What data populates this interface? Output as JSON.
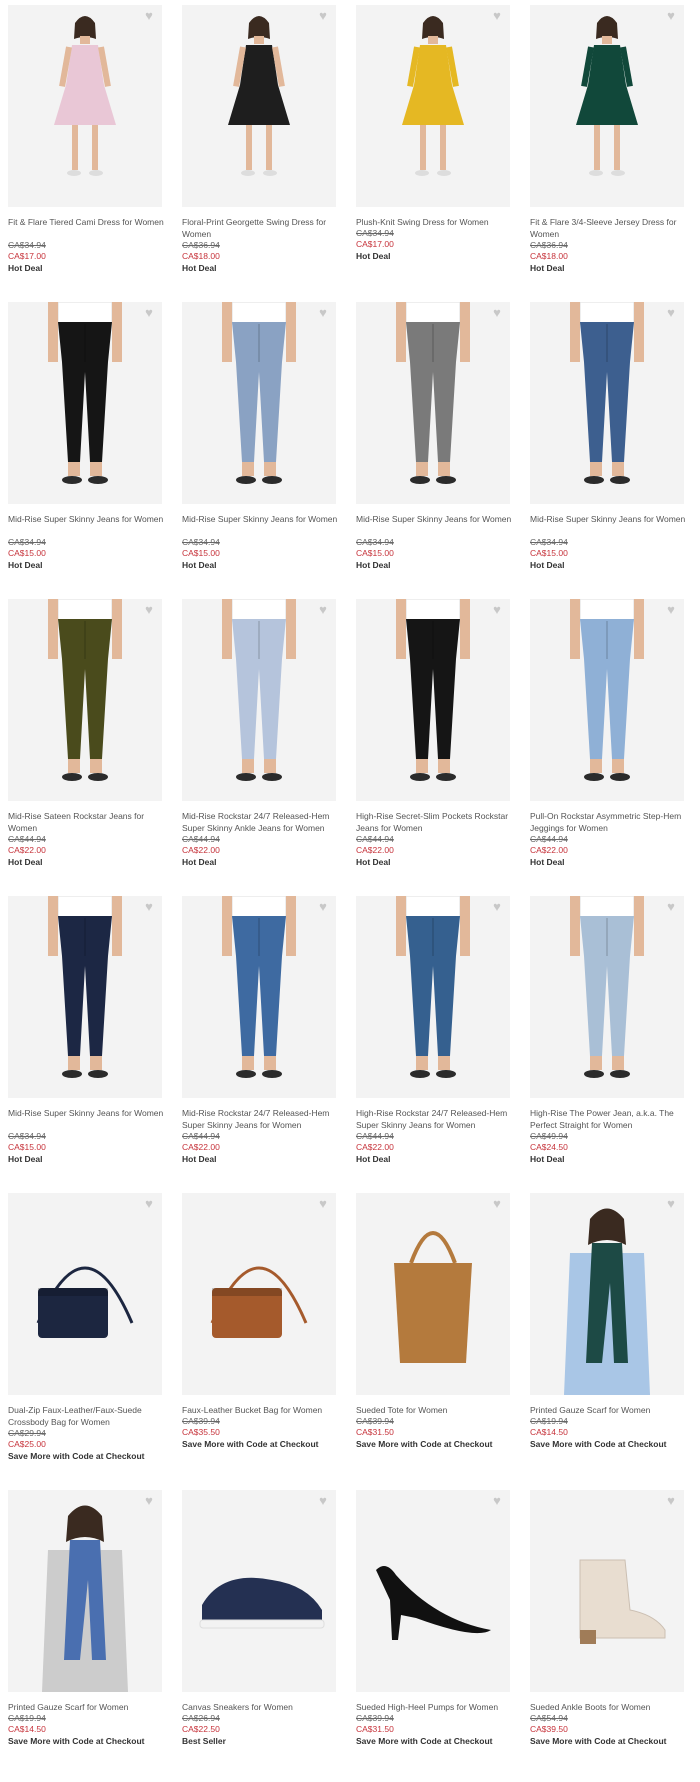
{
  "products": [
    {
      "name": "Fit & Flare Tiered Cami Dress for Women",
      "original_price": "CA$34.94",
      "sale_price": "CA$17.00",
      "tag": "Hot Deal",
      "image": "dress-floral",
      "color": "#e9c7d6"
    },
    {
      "name": "Floral-Print Georgette Swing Dress for Women",
      "original_price": "CA$36.94",
      "sale_price": "CA$18.00",
      "tag": "Hot Deal",
      "image": "dress-black",
      "color": "#1e1e1e"
    },
    {
      "name": "Plush-Knit Swing Dress for Women",
      "original_price": "CA$34.94",
      "sale_price": "CA$17.00",
      "tag": "Hot Deal",
      "image": "dress-yellow",
      "color": "#e5b823"
    },
    {
      "name": "Fit & Flare 3/4-Sleeve Jersey Dress for Women",
      "original_price": "CA$36.94",
      "sale_price": "CA$18.00",
      "tag": "Hot Deal",
      "image": "dress-green",
      "color": "#11483a"
    },
    {
      "name": "Mid-Rise Super Skinny Jeans for Women",
      "original_price": "CA$34.94",
      "sale_price": "CA$15.00",
      "tag": "Hot Deal",
      "image": "jeans-black",
      "color": "#151515"
    },
    {
      "name": "Mid-Rise Super Skinny Jeans for Women",
      "original_price": "CA$34.94",
      "sale_price": "CA$15.00",
      "tag": "Hot Deal",
      "image": "jeans-light",
      "color": "#8aa2c3"
    },
    {
      "name": "Mid-Rise Super Skinny Jeans for Women",
      "original_price": "CA$34.94",
      "sale_price": "CA$15.00",
      "tag": "Hot Deal",
      "image": "jeans-grey",
      "color": "#7a7a7a"
    },
    {
      "name": "Mid-Rise Super Skinny Jeans for Women",
      "original_price": "CA$34.94",
      "sale_price": "CA$15.00",
      "tag": "Hot Deal",
      "image": "jeans-medium",
      "color": "#3d5f8f"
    },
    {
      "name": "Mid-Rise Sateen Rockstar Jeans for Women",
      "original_price": "CA$44.94",
      "sale_price": "CA$22.00",
      "tag": "Hot Deal",
      "image": "jeans-olive",
      "color": "#4a4b1c"
    },
    {
      "name": "Mid-Rise Rockstar 24/7 Released-Hem Super Skinny Ankle Jeans for Women",
      "original_price": "CA$44.94",
      "sale_price": "CA$22.00",
      "tag": "Hot Deal",
      "image": "jeans-pale",
      "color": "#b5c4dc"
    },
    {
      "name": "High-Rise Secret-Slim Pockets Rockstar Jeans for Women",
      "original_price": "CA$44.94",
      "sale_price": "CA$22.00",
      "tag": "Hot Deal",
      "image": "jeans-black2",
      "color": "#151515"
    },
    {
      "name": "Pull-On Rockstar Asymmetric Step-Hem Jeggings for Women",
      "original_price": "CA$44.94",
      "sale_price": "CA$22.00",
      "tag": "Hot Deal",
      "image": "jeans-sky",
      "color": "#8fb0d6"
    },
    {
      "name": "Mid-Rise Super Skinny Jeans for Women",
      "original_price": "CA$34.94",
      "sale_price": "CA$15.00",
      "tag": "Hot Deal",
      "image": "jeans-navy",
      "color": "#1c2744"
    },
    {
      "name": "Mid-Rise Rockstar 24/7 Released-Hem Super Skinny Jeans for Women",
      "original_price": "CA$44.94",
      "sale_price": "CA$22.00",
      "tag": "Hot Deal",
      "image": "jeans-blue",
      "color": "#3e6aa1"
    },
    {
      "name": "High-Rise Rockstar 24/7 Released-Hem Super Skinny Jeans for Women",
      "original_price": "CA$44.94",
      "sale_price": "CA$22.00",
      "tag": "Hot Deal",
      "image": "jeans-blue2",
      "color": "#35608f"
    },
    {
      "name": "High-Rise The Power Jean, a.k.a. The Perfect Straight for Women",
      "original_price": "CA$49.94",
      "sale_price": "CA$24.50",
      "tag": "Hot Deal",
      "image": "jeans-bleach",
      "color": "#a9bfd6"
    },
    {
      "name": "Dual-Zip Faux-Leather/Faux-Suede Crossbody Bag for Women",
      "original_price": "CA$29.94",
      "sale_price": "CA$25.00",
      "tag": "Save More with Code at Checkout",
      "image": "bag-navy",
      "color": "#1c2640"
    },
    {
      "name": "Faux-Leather Bucket Bag for Women",
      "original_price": "CA$39.94",
      "sale_price": "CA$35.50",
      "tag": "Save More with Code at Checkout",
      "image": "bag-cognac",
      "color": "#a55a2c"
    },
    {
      "name": "Sueded Tote for Women",
      "original_price": "CA$39.94",
      "sale_price": "CA$31.50",
      "tag": "Save More with Code at Checkout",
      "image": "tote-tan",
      "color": "#b47a3d"
    },
    {
      "name": "Printed Gauze Scarf for Women",
      "original_price": "CA$19.94",
      "sale_price": "CA$14.50",
      "tag": "Save More with Code at Checkout",
      "image": "scarf-green",
      "color": "#1d4a45"
    },
    {
      "name": "Printed Gauze Scarf for Women",
      "original_price": "CA$19.94",
      "sale_price": "CA$14.50",
      "tag": "Save More with Code at Checkout",
      "image": "scarf-blue",
      "color": "#4a6fb0"
    },
    {
      "name": "Canvas Sneakers for Women",
      "original_price": "CA$26.94",
      "sale_price": "CA$22.50",
      "tag": "Best Seller",
      "image": "sneaker-navy",
      "color": "#243052"
    },
    {
      "name": "Sueded High-Heel Pumps for Women",
      "original_price": "CA$39.94",
      "sale_price": "CA$31.50",
      "tag": "Save More with Code at Checkout",
      "image": "pump-black",
      "color": "#111111"
    },
    {
      "name": "Sueded Ankle Boots for Women",
      "original_price": "CA$54.94",
      "sale_price": "CA$39.50",
      "tag": "Save More with Code at Checkout",
      "image": "boot-cream",
      "color": "#e8ddd0"
    }
  ],
  "icons": {
    "favorite": "heart-icon"
  }
}
